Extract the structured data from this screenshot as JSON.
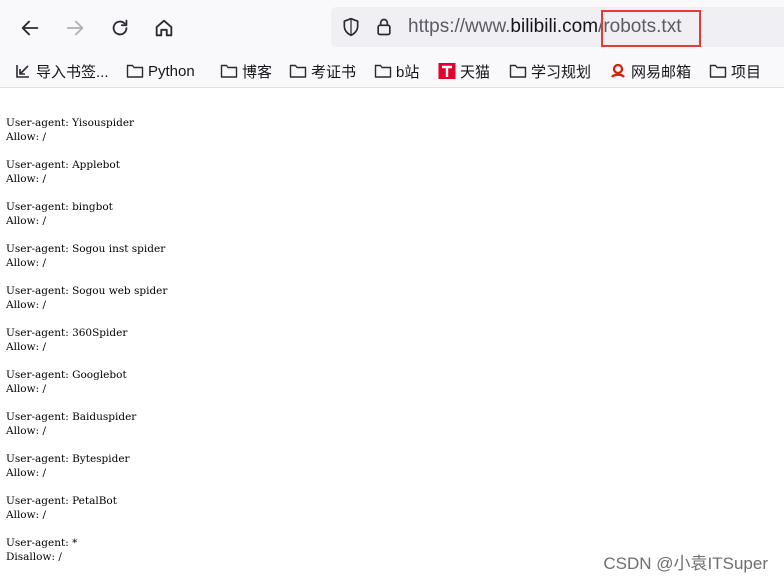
{
  "browser": {
    "url": {
      "scheme": "https://www.",
      "host": "bilibili.com",
      "path": "/robots.txt"
    }
  },
  "bookmarks": [
    {
      "label": "导入书签...",
      "icon": "import-icon"
    },
    {
      "label": "Python",
      "icon": "folder-icon"
    },
    {
      "label": "博客",
      "icon": "folder-icon"
    },
    {
      "label": "考证书",
      "icon": "folder-icon"
    },
    {
      "label": "b站",
      "icon": "folder-icon"
    },
    {
      "label": "天猫",
      "icon": "tmall-icon"
    },
    {
      "label": "学习规划",
      "icon": "folder-icon"
    },
    {
      "label": "网易邮箱",
      "icon": "netease-mail-icon"
    },
    {
      "label": "项目",
      "icon": "folder-icon"
    }
  ],
  "robots": [
    {
      "agent": "User-agent: Yisouspider",
      "rule": "Allow: /"
    },
    {
      "agent": "User-agent: Applebot",
      "rule": "Allow: /"
    },
    {
      "agent": "User-agent: bingbot",
      "rule": "Allow: /"
    },
    {
      "agent": "User-agent: Sogou inst spider",
      "rule": "Allow: /"
    },
    {
      "agent": "User-agent: Sogou web spider",
      "rule": "Allow: /"
    },
    {
      "agent": "User-agent: 360Spider",
      "rule": "Allow: /"
    },
    {
      "agent": "User-agent: Googlebot",
      "rule": "Allow: /"
    },
    {
      "agent": "User-agent: Baiduspider",
      "rule": "Allow: /"
    },
    {
      "agent": "User-agent: Bytespider",
      "rule": "Allow: /"
    },
    {
      "agent": "User-agent: PetalBot",
      "rule": "Allow: /"
    },
    {
      "agent": "User-agent: *",
      "rule": "Disallow: /"
    }
  ],
  "watermark": "CSDN @小袁ITSuper",
  "colors": {
    "highlight": "#e53935",
    "toolbar_bg": "#f9f9fb",
    "urlbar_bg": "#f0f0f4"
  }
}
